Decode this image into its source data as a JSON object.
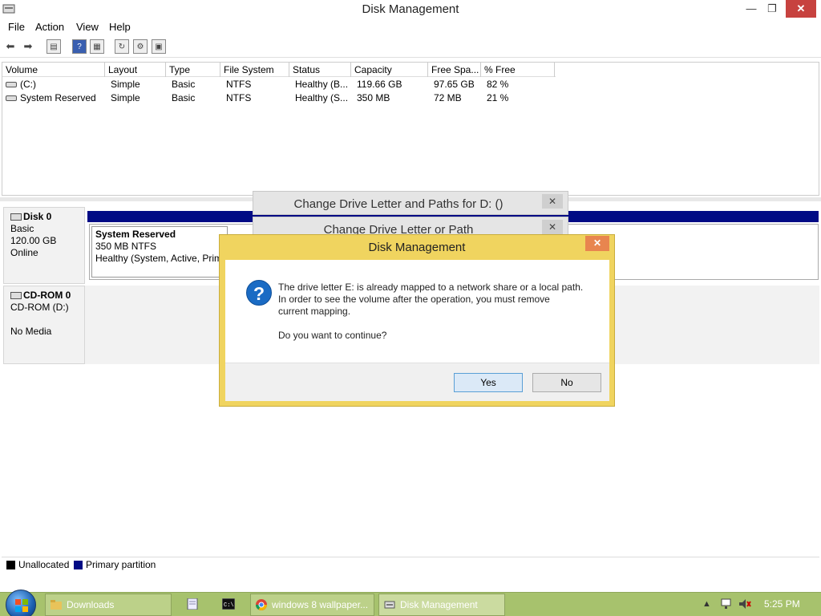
{
  "window": {
    "title": "Disk Management"
  },
  "menu": {
    "file": "File",
    "action": "Action",
    "view": "View",
    "help": "Help"
  },
  "volume_table": {
    "columns": [
      "Volume",
      "Layout",
      "Type",
      "File System",
      "Status",
      "Capacity",
      "Free Spa...",
      "% Free"
    ],
    "rows": [
      {
        "volume": "(C:)",
        "layout": "Simple",
        "type": "Basic",
        "fs": "NTFS",
        "status": "Healthy (B...",
        "capacity": "119.66 GB",
        "free": "97.65 GB",
        "pct": "82 %"
      },
      {
        "volume": "System Reserved",
        "layout": "Simple",
        "type": "Basic",
        "fs": "NTFS",
        "status": "Healthy (S...",
        "capacity": "350 MB",
        "free": "72 MB",
        "pct": "21 %"
      }
    ]
  },
  "disks": {
    "disk0": {
      "name": "Disk 0",
      "type": "Basic",
      "size": "120.00 GB",
      "state": "Online"
    },
    "partition": {
      "name": "System Reserved",
      "size": "350 MB NTFS",
      "status": "Healthy (System, Active, Prima"
    },
    "cdrom": {
      "name": "CD-ROM 0",
      "drive": "CD-ROM (D:)",
      "media": "No Media"
    }
  },
  "legend": {
    "unallocated": "Unallocated",
    "primary": "Primary partition"
  },
  "bg_dialogs": {
    "first": "Change Drive Letter and Paths for D: ()",
    "second": "Change Drive Letter or Path"
  },
  "modal": {
    "title": "Disk Management",
    "line1": "The drive letter E: is already mapped to a network share or a local path.",
    "line2": "In order to see the volume after the operation, you must remove",
    "line3": "current mapping.",
    "question": "Do you want to continue?",
    "yes": "Yes",
    "no": "No"
  },
  "taskbar": {
    "items": [
      "Downloads",
      "windows 8 wallpaper...",
      "Disk Management"
    ],
    "time": "5:25 PM"
  },
  "colors": {
    "primary_partition": "#000b85",
    "modal_frame": "#f0d45f",
    "taskbar": "#a7c26d"
  }
}
